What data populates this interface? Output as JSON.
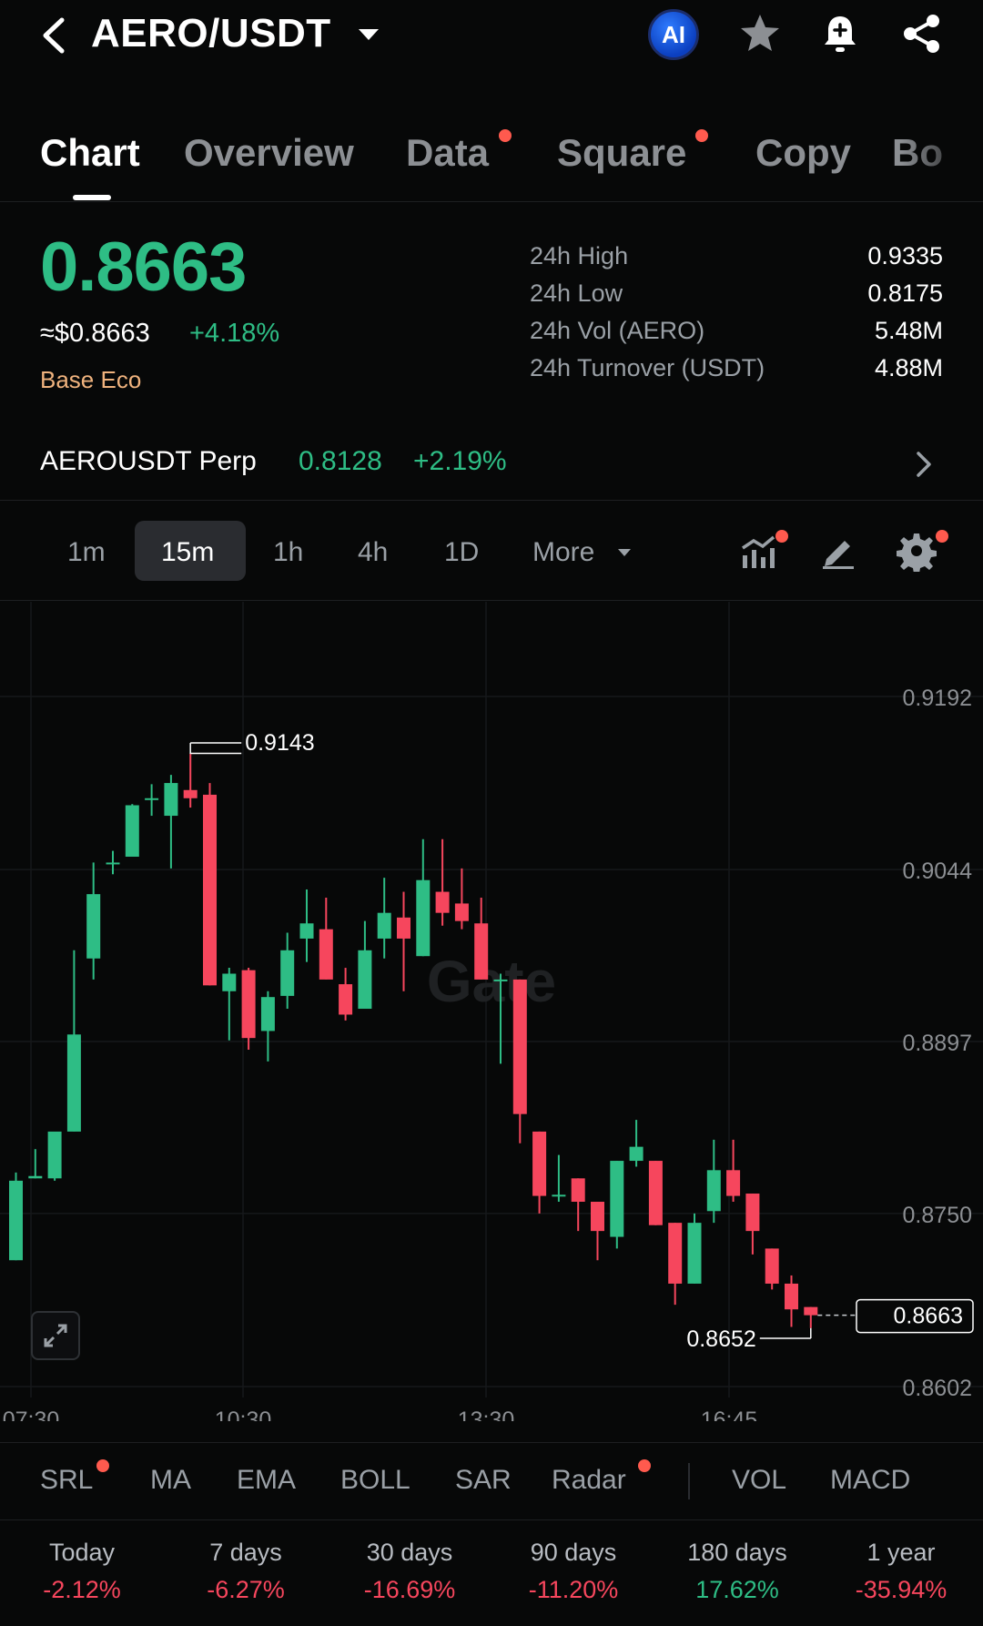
{
  "header": {
    "pair": "AERO/USDT",
    "ai_label": "AI"
  },
  "tabs": [
    {
      "label": "Chart"
    },
    {
      "label": "Overview"
    },
    {
      "label": "Data"
    },
    {
      "label": "Square"
    },
    {
      "label": "Copy"
    },
    {
      "label": "Bo"
    }
  ],
  "ticker": {
    "price": "0.8663",
    "usd_price": "≈$0.8663",
    "change": "+4.18%",
    "eco_tag": "Base Eco",
    "stats": [
      {
        "label": "24h High",
        "value": "0.9335"
      },
      {
        "label": "24h Low",
        "value": "0.8175"
      },
      {
        "label": "24h Vol (AERO)",
        "value": "5.48M"
      },
      {
        "label": "24h Turnover (USDT)",
        "value": "4.88M"
      }
    ]
  },
  "perp": {
    "name": "AEROUSDT Perp",
    "price": "0.8128",
    "change": "+2.19%"
  },
  "intervals": {
    "items": [
      "1m",
      "15m",
      "1h",
      "4h",
      "1D"
    ],
    "selected": "15m",
    "more_label": "More"
  },
  "chart_data": {
    "type": "candlestick",
    "watermark": "Gate",
    "y_ticks": [
      "0.9192",
      "0.9044",
      "0.8897",
      "0.8750",
      "0.8602"
    ],
    "x_ticks": [
      "07:30",
      "10:30",
      "13:30",
      "16:45"
    ],
    "ylim": [
      0.8602,
      0.9192
    ],
    "high_marker": "0.9143",
    "low_marker": "0.8652",
    "last_price": "0.8663",
    "colors": {
      "up": "#2ebd85",
      "down": "#f6465d"
    },
    "candles": [
      {
        "o": 0.871,
        "h": 0.8785,
        "l": 0.871,
        "c": 0.8778
      },
      {
        "o": 0.878,
        "h": 0.8805,
        "l": 0.878,
        "c": 0.8782
      },
      {
        "o": 0.878,
        "h": 0.8808,
        "l": 0.8778,
        "c": 0.882
      },
      {
        "o": 0.882,
        "h": 0.8975,
        "l": 0.882,
        "c": 0.8903
      },
      {
        "o": 0.8968,
        "h": 0.905,
        "l": 0.895,
        "c": 0.9023
      },
      {
        "o": 0.905,
        "h": 0.906,
        "l": 0.904,
        "c": 0.905
      },
      {
        "o": 0.9055,
        "h": 0.91,
        "l": 0.9055,
        "c": 0.9099
      },
      {
        "o": 0.9105,
        "h": 0.9117,
        "l": 0.909,
        "c": 0.9105
      },
      {
        "o": 0.909,
        "h": 0.9125,
        "l": 0.9045,
        "c": 0.9118
      },
      {
        "o": 0.9112,
        "h": 0.9143,
        "l": 0.9097,
        "c": 0.9105
      },
      {
        "o": 0.9108,
        "h": 0.9118,
        "l": 0.8945,
        "c": 0.8945
      },
      {
        "o": 0.894,
        "h": 0.896,
        "l": 0.8898,
        "c": 0.8955
      },
      {
        "o": 0.8958,
        "h": 0.896,
        "l": 0.889,
        "c": 0.89
      },
      {
        "o": 0.8906,
        "h": 0.894,
        "l": 0.888,
        "c": 0.8935
      },
      {
        "o": 0.8936,
        "h": 0.899,
        "l": 0.8925,
        "c": 0.8975
      },
      {
        "o": 0.8985,
        "h": 0.9027,
        "l": 0.8965,
        "c": 0.8998
      },
      {
        "o": 0.8993,
        "h": 0.902,
        "l": 0.895,
        "c": 0.895
      },
      {
        "o": 0.8946,
        "h": 0.896,
        "l": 0.8915,
        "c": 0.892
      },
      {
        "o": 0.8925,
        "h": 0.9,
        "l": 0.8925,
        "c": 0.8975
      },
      {
        "o": 0.8985,
        "h": 0.9037,
        "l": 0.8968,
        "c": 0.9007
      },
      {
        "o": 0.9003,
        "h": 0.9025,
        "l": 0.894,
        "c": 0.8985
      },
      {
        "o": 0.897,
        "h": 0.907,
        "l": 0.897,
        "c": 0.9035
      },
      {
        "o": 0.9025,
        "h": 0.907,
        "l": 0.8996,
        "c": 0.9007
      },
      {
        "o": 0.9015,
        "h": 0.9045,
        "l": 0.8993,
        "c": 0.9
      },
      {
        "o": 0.8998,
        "h": 0.902,
        "l": 0.895,
        "c": 0.895
      },
      {
        "o": 0.895,
        "h": 0.8955,
        "l": 0.8878,
        "c": 0.895
      },
      {
        "o": 0.895,
        "h": 0.895,
        "l": 0.881,
        "c": 0.8835
      },
      {
        "o": 0.882,
        "h": 0.882,
        "l": 0.875,
        "c": 0.8765
      },
      {
        "o": 0.8766,
        "h": 0.88,
        "l": 0.876,
        "c": 0.8766
      },
      {
        "o": 0.878,
        "h": 0.878,
        "l": 0.8735,
        "c": 0.876
      },
      {
        "o": 0.876,
        "h": 0.876,
        "l": 0.871,
        "c": 0.8735
      },
      {
        "o": 0.873,
        "h": 0.8795,
        "l": 0.872,
        "c": 0.8795
      },
      {
        "o": 0.8795,
        "h": 0.883,
        "l": 0.879,
        "c": 0.8807
      },
      {
        "o": 0.8795,
        "h": 0.8795,
        "l": 0.874,
        "c": 0.874
      },
      {
        "o": 0.8742,
        "h": 0.8742,
        "l": 0.8672,
        "c": 0.869
      },
      {
        "o": 0.869,
        "h": 0.875,
        "l": 0.869,
        "c": 0.8742
      },
      {
        "o": 0.8752,
        "h": 0.8813,
        "l": 0.8742,
        "c": 0.8787
      },
      {
        "o": 0.8787,
        "h": 0.8813,
        "l": 0.876,
        "c": 0.8765
      },
      {
        "o": 0.8767,
        "h": 0.8767,
        "l": 0.8715,
        "c": 0.8735
      },
      {
        "o": 0.872,
        "h": 0.872,
        "l": 0.8685,
        "c": 0.869
      },
      {
        "o": 0.869,
        "h": 0.8697,
        "l": 0.8653,
        "c": 0.8668
      },
      {
        "o": 0.867,
        "h": 0.867,
        "l": 0.8652,
        "c": 0.8663
      }
    ]
  },
  "indicators": [
    "SRL",
    "MA",
    "EMA",
    "BOLL",
    "SAR",
    "Radar",
    "VOL",
    "MACD"
  ],
  "performance": [
    {
      "label": "Today",
      "value": "-2.12%",
      "dir": "down"
    },
    {
      "label": "7 days",
      "value": "-6.27%",
      "dir": "down"
    },
    {
      "label": "30 days",
      "value": "-16.69%",
      "dir": "down"
    },
    {
      "label": "90 days",
      "value": "-11.20%",
      "dir": "down"
    },
    {
      "label": "180 days",
      "value": "17.62%",
      "dir": "up"
    },
    {
      "label": "1 year",
      "value": "-35.94%",
      "dir": "down"
    }
  ]
}
